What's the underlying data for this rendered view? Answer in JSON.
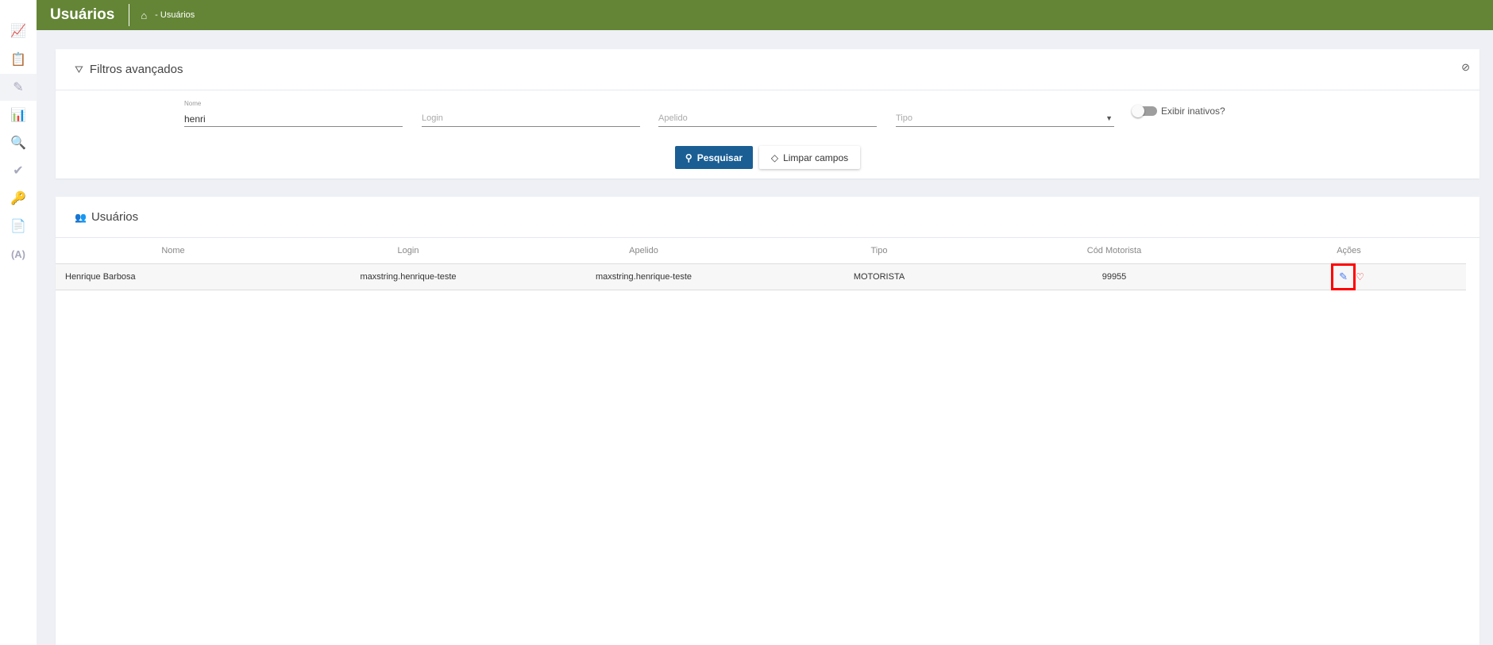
{
  "header": {
    "title": "Usuários",
    "breadcrumb": "- Usuários"
  },
  "sidebar": {
    "items": [
      "presentation-chart",
      "clipboard",
      "pencil",
      "bar-chart",
      "search",
      "double-check",
      "key",
      "document",
      "antenna"
    ]
  },
  "filters": {
    "title": "Filtros avançados",
    "nome_label": "Nome",
    "nome_value": "henri",
    "login_placeholder": "Login",
    "apelido_placeholder": "Apelido",
    "tipo_placeholder": "Tipo",
    "toggle_label": "Exibir inativos?",
    "toggle_on": false,
    "search_button": "Pesquisar",
    "clear_button": "Limpar campos"
  },
  "users": {
    "title": "Usuários",
    "columns": [
      "Nome",
      "Login",
      "Apelido",
      "Tipo",
      "Cód Motorista",
      "Ações"
    ],
    "rows": [
      {
        "nome": "Henrique Barbosa",
        "login": "maxstring.henrique-teste",
        "apelido": "maxstring.henrique-teste",
        "tipo": "MOTORISTA",
        "cod": "99955"
      }
    ]
  },
  "colors": {
    "brand": "#638535",
    "primary": "#1a5e94",
    "highlight": "#ff0000"
  }
}
